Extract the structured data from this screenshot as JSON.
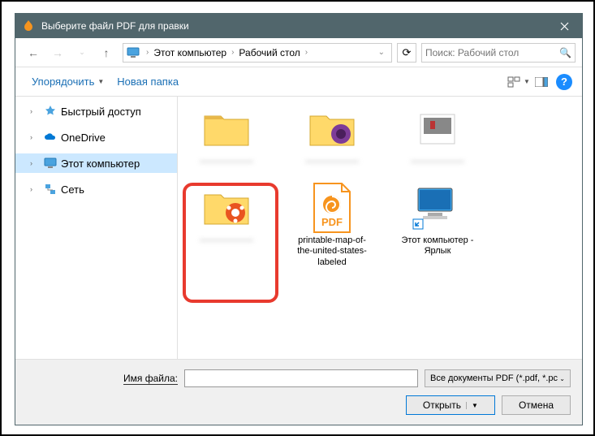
{
  "title": "Выберите файл PDF для правки",
  "breadcrumb": {
    "items": [
      "Этот компьютер",
      "Рабочий стол"
    ]
  },
  "search": {
    "placeholder": "Поиск: Рабочий стол"
  },
  "toolbar": {
    "organize": "Упорядочить",
    "newfolder": "Новая папка"
  },
  "sidebar": {
    "items": [
      {
        "label": "Быстрый доступ",
        "icon": "star"
      },
      {
        "label": "OneDrive",
        "icon": "cloud"
      },
      {
        "label": "Этот компьютер",
        "icon": "pc",
        "selected": true
      },
      {
        "label": "Сеть",
        "icon": "network"
      }
    ]
  },
  "files": {
    "folder1_label": "——————",
    "pdf_label": "printable-map-of-the-united-states-labeled",
    "pc_label": "Этот компьютер - Ярлык"
  },
  "bottom": {
    "filename_label": "Имя файла:",
    "filter": "Все документы PDF (*.pdf, *.pc",
    "open": "Открыть",
    "cancel": "Отмена"
  }
}
